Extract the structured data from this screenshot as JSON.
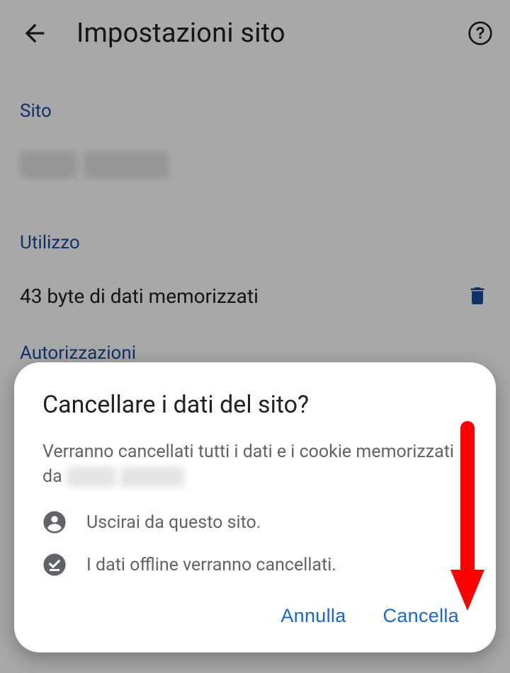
{
  "header": {
    "title": "Impostazioni sito"
  },
  "sections": {
    "site_label": "Sito",
    "usage_label": "Utilizzo",
    "permissions_label": "Autorizzazioni"
  },
  "usage": {
    "text": "43 byte di dati memorizzati"
  },
  "dialog": {
    "title": "Cancellare i dati del sito?",
    "body_prefix": "Verranno cancellati tutti i dati e i cookie memorizzati da ",
    "bullet_signout": "Uscirai da questo sito.",
    "bullet_offline": "I dati offline verranno cancellati.",
    "cancel": "Annulla",
    "confirm": "Cancella"
  }
}
